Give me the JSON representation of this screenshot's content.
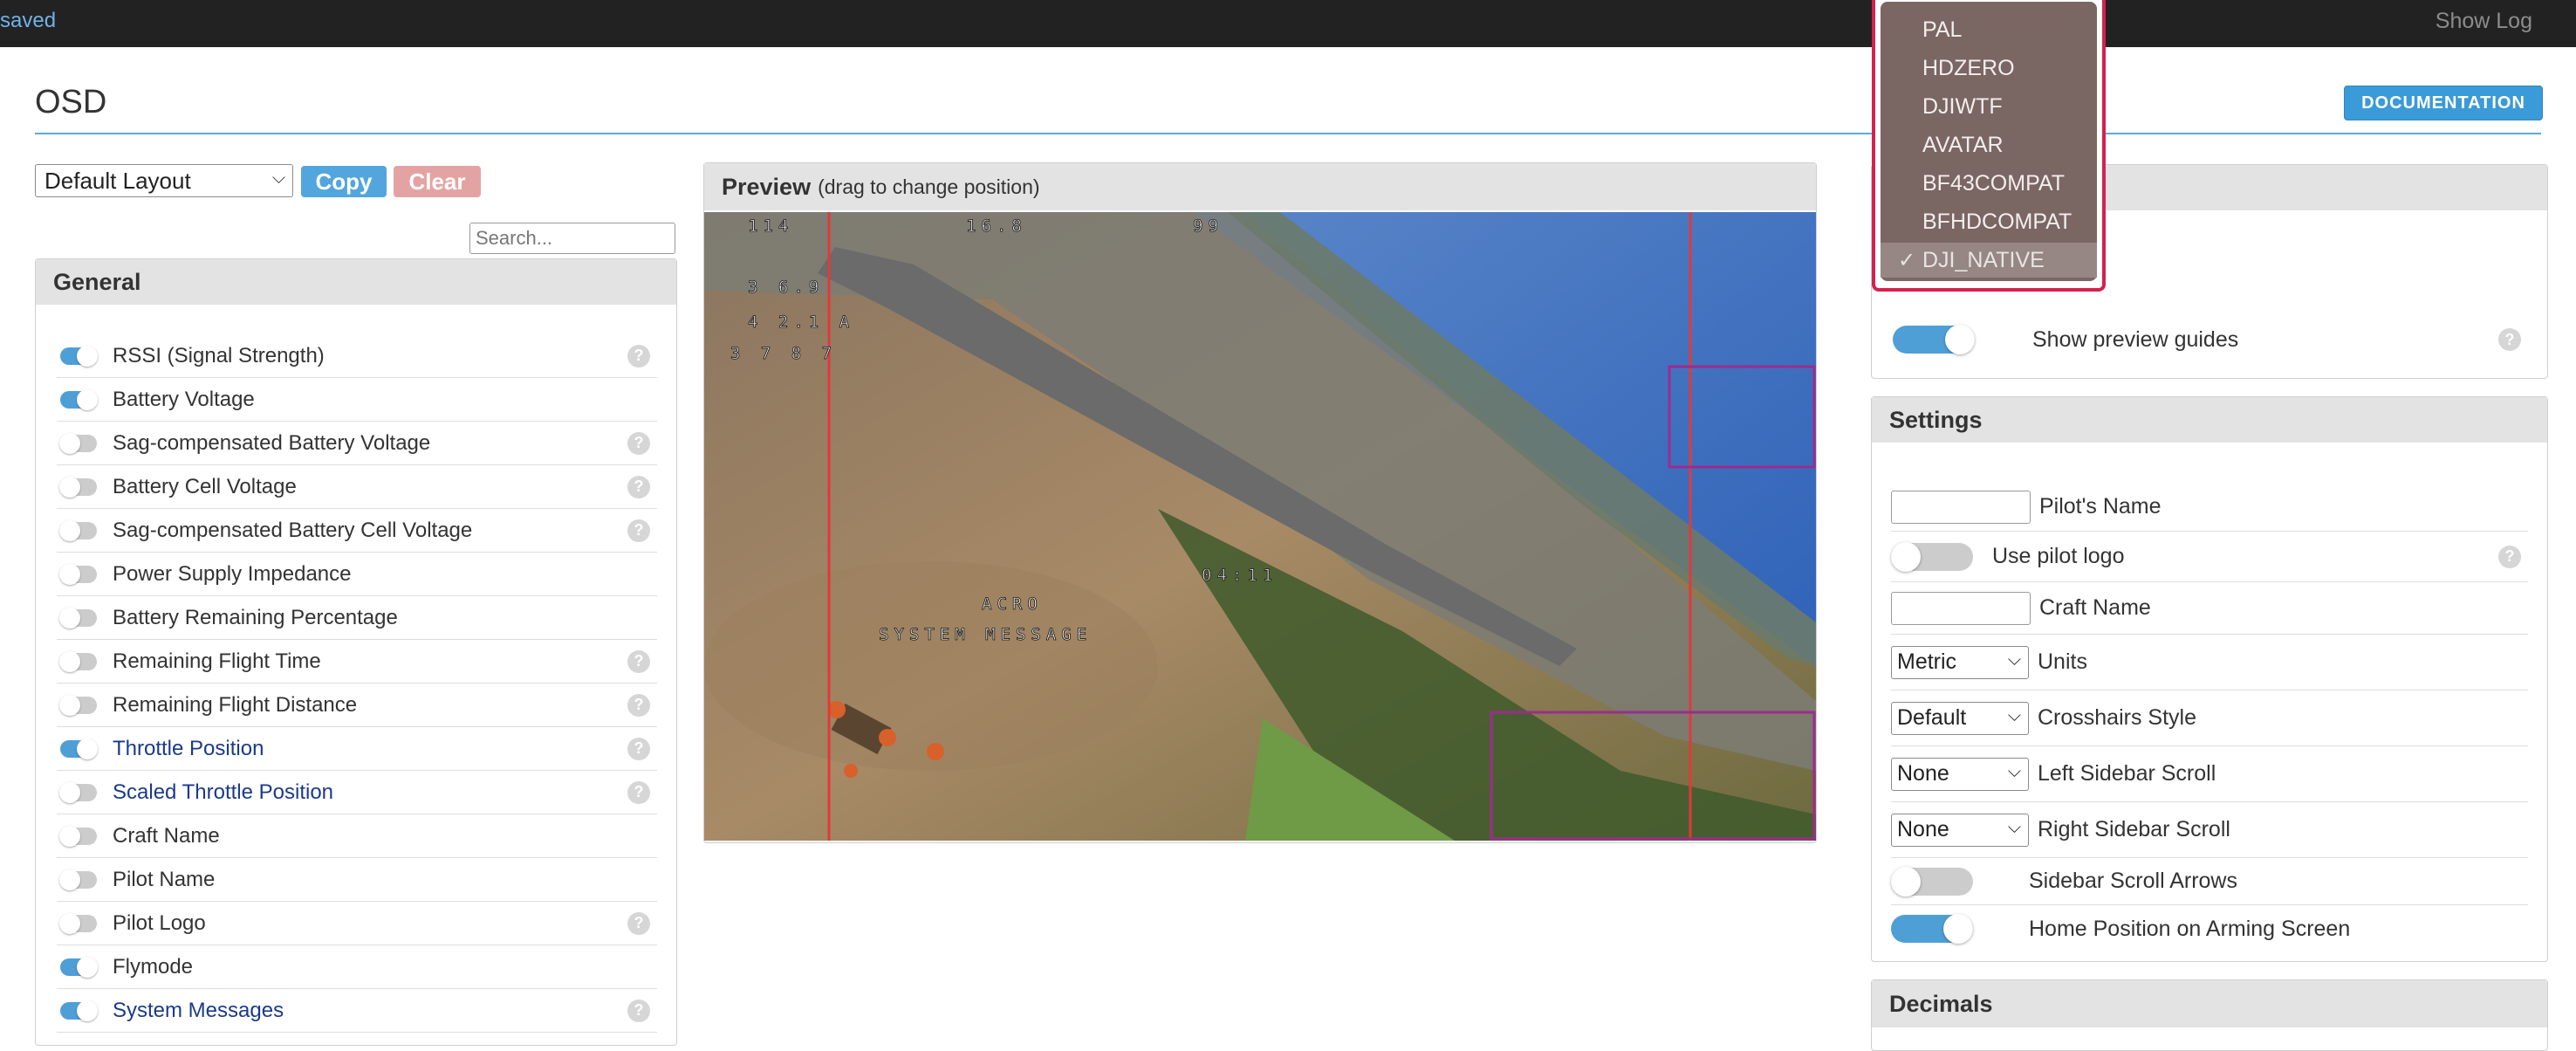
{
  "topbar": {
    "status": "saved",
    "show_log": "Show Log"
  },
  "page": {
    "title": "OSD",
    "documentation": "DOCUMENTATION"
  },
  "layout": {
    "selected": "Default Layout",
    "copy": "Copy",
    "clear": "Clear"
  },
  "search": {
    "placeholder": "Search..."
  },
  "general": {
    "title": "General",
    "items": [
      {
        "label": "RSSI (Signal Strength)",
        "enabled": true,
        "help": true,
        "highlight": false
      },
      {
        "label": "Battery Voltage",
        "enabled": true,
        "help": false,
        "highlight": false
      },
      {
        "label": "Sag-compensated Battery Voltage",
        "enabled": false,
        "help": true,
        "highlight": false
      },
      {
        "label": "Battery Cell Voltage",
        "enabled": false,
        "help": true,
        "highlight": false
      },
      {
        "label": "Sag-compensated Battery Cell Voltage",
        "enabled": false,
        "help": true,
        "highlight": false
      },
      {
        "label": "Power Supply Impedance",
        "enabled": false,
        "help": false,
        "highlight": false
      },
      {
        "label": "Battery Remaining Percentage",
        "enabled": false,
        "help": false,
        "highlight": false
      },
      {
        "label": "Remaining Flight Time",
        "enabled": false,
        "help": true,
        "highlight": false
      },
      {
        "label": "Remaining Flight Distance",
        "enabled": false,
        "help": true,
        "highlight": false
      },
      {
        "label": "Throttle Position",
        "enabled": true,
        "help": true,
        "highlight": true
      },
      {
        "label": "Scaled Throttle Position",
        "enabled": false,
        "help": true,
        "highlight": true
      },
      {
        "label": "Craft Name",
        "enabled": false,
        "help": false,
        "highlight": false
      },
      {
        "label": "Pilot Name",
        "enabled": false,
        "help": false,
        "highlight": false
      },
      {
        "label": "Pilot Logo",
        "enabled": false,
        "help": true,
        "highlight": false
      },
      {
        "label": "Flymode",
        "enabled": true,
        "help": false,
        "highlight": false
      },
      {
        "label": "System Messages",
        "enabled": true,
        "help": true,
        "highlight": true
      }
    ]
  },
  "preview": {
    "title": "Preview",
    "subtitle": "(drag to change position)",
    "osd": {
      "rssi": "114",
      "battery": "16.8",
      "signal": "99",
      "line2": "3 6.9",
      "line3": "4 2.1 A",
      "line4": "3 7 8 7",
      "timer": "04:11",
      "mode": "ACRO",
      "message": "SYSTEM MESSAGE"
    }
  },
  "video_format": {
    "options": [
      "PAL",
      "HDZERO",
      "DJIWTF",
      "AVATAR",
      "BF43COMPAT",
      "BFHDCOMPAT",
      "DJI_NATIVE"
    ],
    "selected": "DJI_NATIVE"
  },
  "guides": {
    "label": "Show preview guides",
    "enabled": true
  },
  "settings": {
    "title": "Settings",
    "pilot_name": {
      "label": "Pilot's Name",
      "value": ""
    },
    "pilot_logo": {
      "label": "Use pilot logo",
      "enabled": false
    },
    "craft_name": {
      "label": "Craft Name",
      "value": ""
    },
    "units": {
      "label": "Units",
      "value": "Metric"
    },
    "crosshairs": {
      "label": "Crosshairs Style",
      "value": "Default"
    },
    "left_scroll": {
      "label": "Left Sidebar Scroll",
      "value": "None"
    },
    "right_scroll": {
      "label": "Right Sidebar Scroll",
      "value": "None"
    },
    "scroll_arrows": {
      "label": "Sidebar Scroll Arrows",
      "enabled": false
    },
    "home_position": {
      "label": "Home Position on Arming Screen",
      "enabled": true
    }
  },
  "decimals": {
    "title": "Decimals"
  },
  "colors": {
    "accent": "#4f9fd7",
    "danger": "#d4214f",
    "guide_red": "#e03a3a",
    "guide_purple": "#9b2d8e"
  }
}
